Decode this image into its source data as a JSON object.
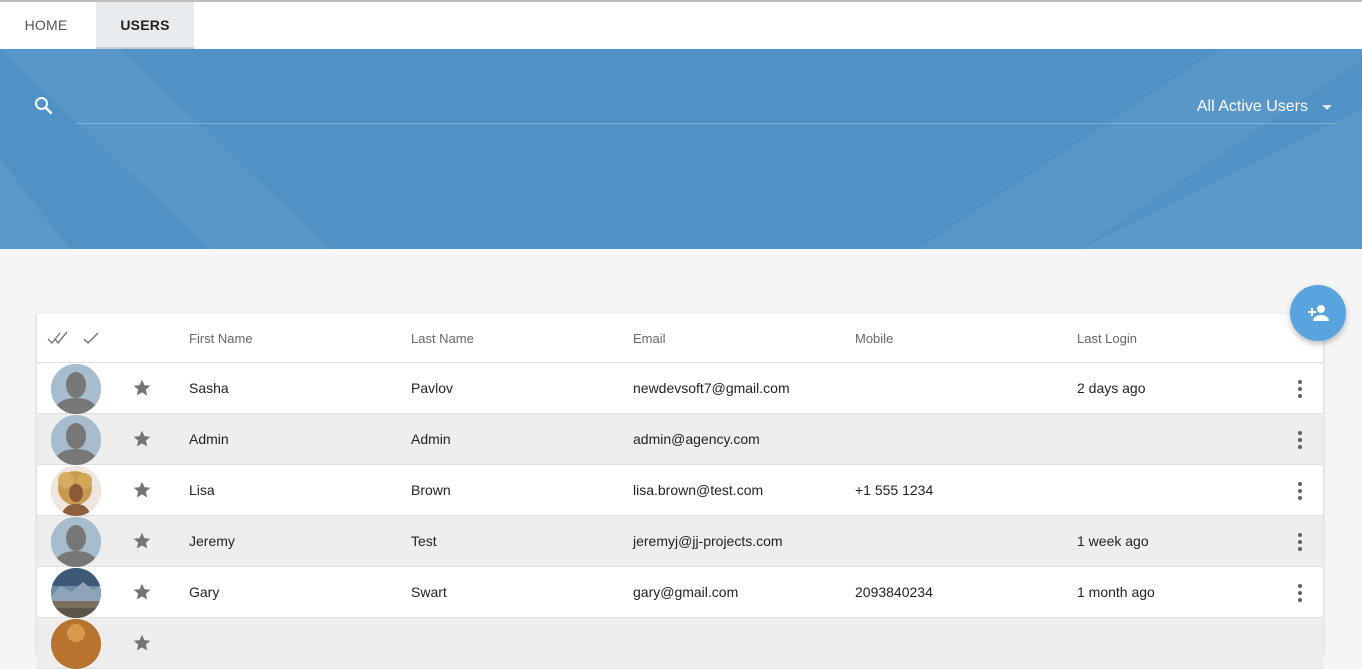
{
  "tabs": [
    {
      "label": "HOME"
    },
    {
      "label": "USERS"
    }
  ],
  "filter": {
    "label": "All Active Users"
  },
  "table": {
    "columns": {
      "first_name": "First Name",
      "last_name": "Last Name",
      "email": "Email",
      "mobile": "Mobile",
      "last_login": "Last Login"
    },
    "rows": [
      {
        "first": "Sasha",
        "last": "Pavlov",
        "email": "newdevsoft7@gmail.com",
        "mobile": "",
        "login": "2 days ago"
      },
      {
        "first": "Admin",
        "last": "Admin",
        "email": "admin@agency.com",
        "mobile": "",
        "login": ""
      },
      {
        "first": "Lisa",
        "last": "Brown",
        "email": "lisa.brown@test.com",
        "mobile": "+1 555 1234",
        "login": ""
      },
      {
        "first": "Jeremy",
        "last": "Test",
        "email": "jeremyj@jj-projects.com",
        "mobile": "",
        "login": "1 week ago"
      },
      {
        "first": "Gary",
        "last": "Swart",
        "email": "gary@gmail.com",
        "mobile": "2093840234",
        "login": "1 month ago"
      }
    ]
  },
  "colors": {
    "banner": "#5092c6",
    "fab": "#59a3de",
    "star": "#757575"
  }
}
